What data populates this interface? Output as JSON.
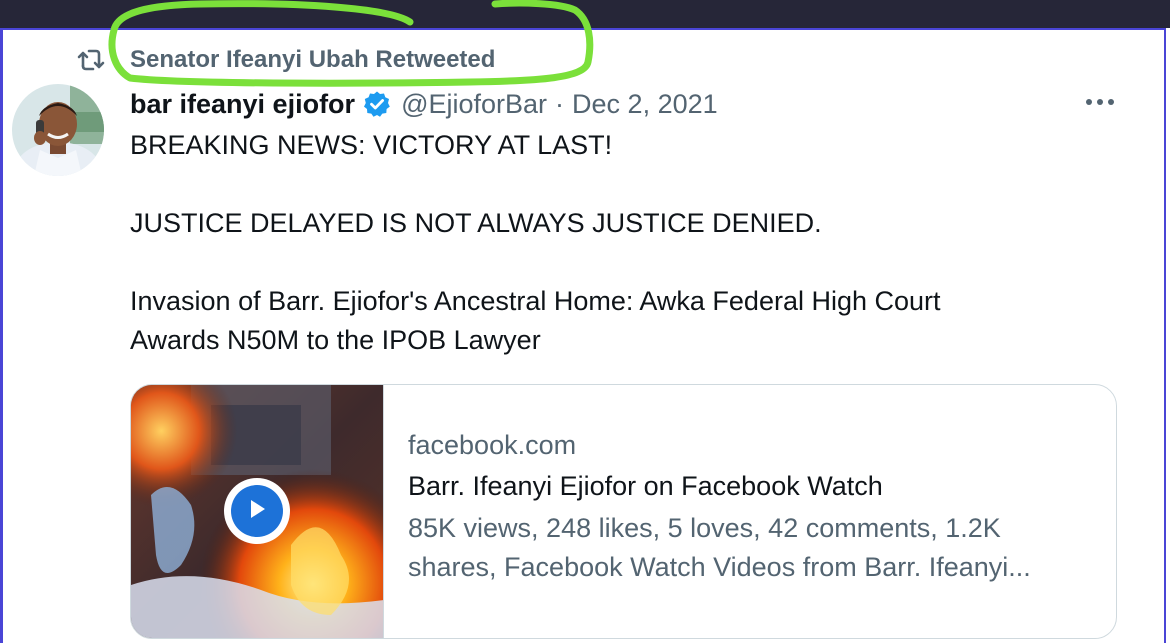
{
  "colors": {
    "top_bar": "#262638",
    "border": "#4a45d6",
    "highlight": "#7be03a",
    "secondary_text": "#536471",
    "primary_text": "#0f1419",
    "verified_badge": "#1d9bf0",
    "play_button": "#1d72d8"
  },
  "retweet": {
    "icon": "retweet-icon",
    "label": "Senator Ifeanyi Ubah Retweeted"
  },
  "author": {
    "display_name": "bar ifeanyi ejiofor",
    "verified_icon": "verified-badge-icon",
    "handle": "@EjioforBar",
    "separator": "·",
    "date": "Dec 2, 2021"
  },
  "more_icon": "more-horizontal-icon",
  "tweet": {
    "line1": "BREAKING NEWS: VICTORY AT LAST!",
    "line2": "JUSTICE DELAYED IS NOT ALWAYS JUSTICE DENIED.",
    "line3a": "Invasion of Barr. Ejiofor's Ancestral Home: Awka Federal High Court",
    "line3b": "Awards N50M to the IPOB Lawyer"
  },
  "card": {
    "domain": "facebook.com",
    "title": "Barr. Ifeanyi Ejiofor on Facebook Watch",
    "desc_line1": "85K views, 248 likes, 5 loves, 42 comments, 1.2K",
    "desc_line2": "shares, Facebook Watch Videos from Barr. Ifeanyi...",
    "play_icon": "play-icon"
  }
}
